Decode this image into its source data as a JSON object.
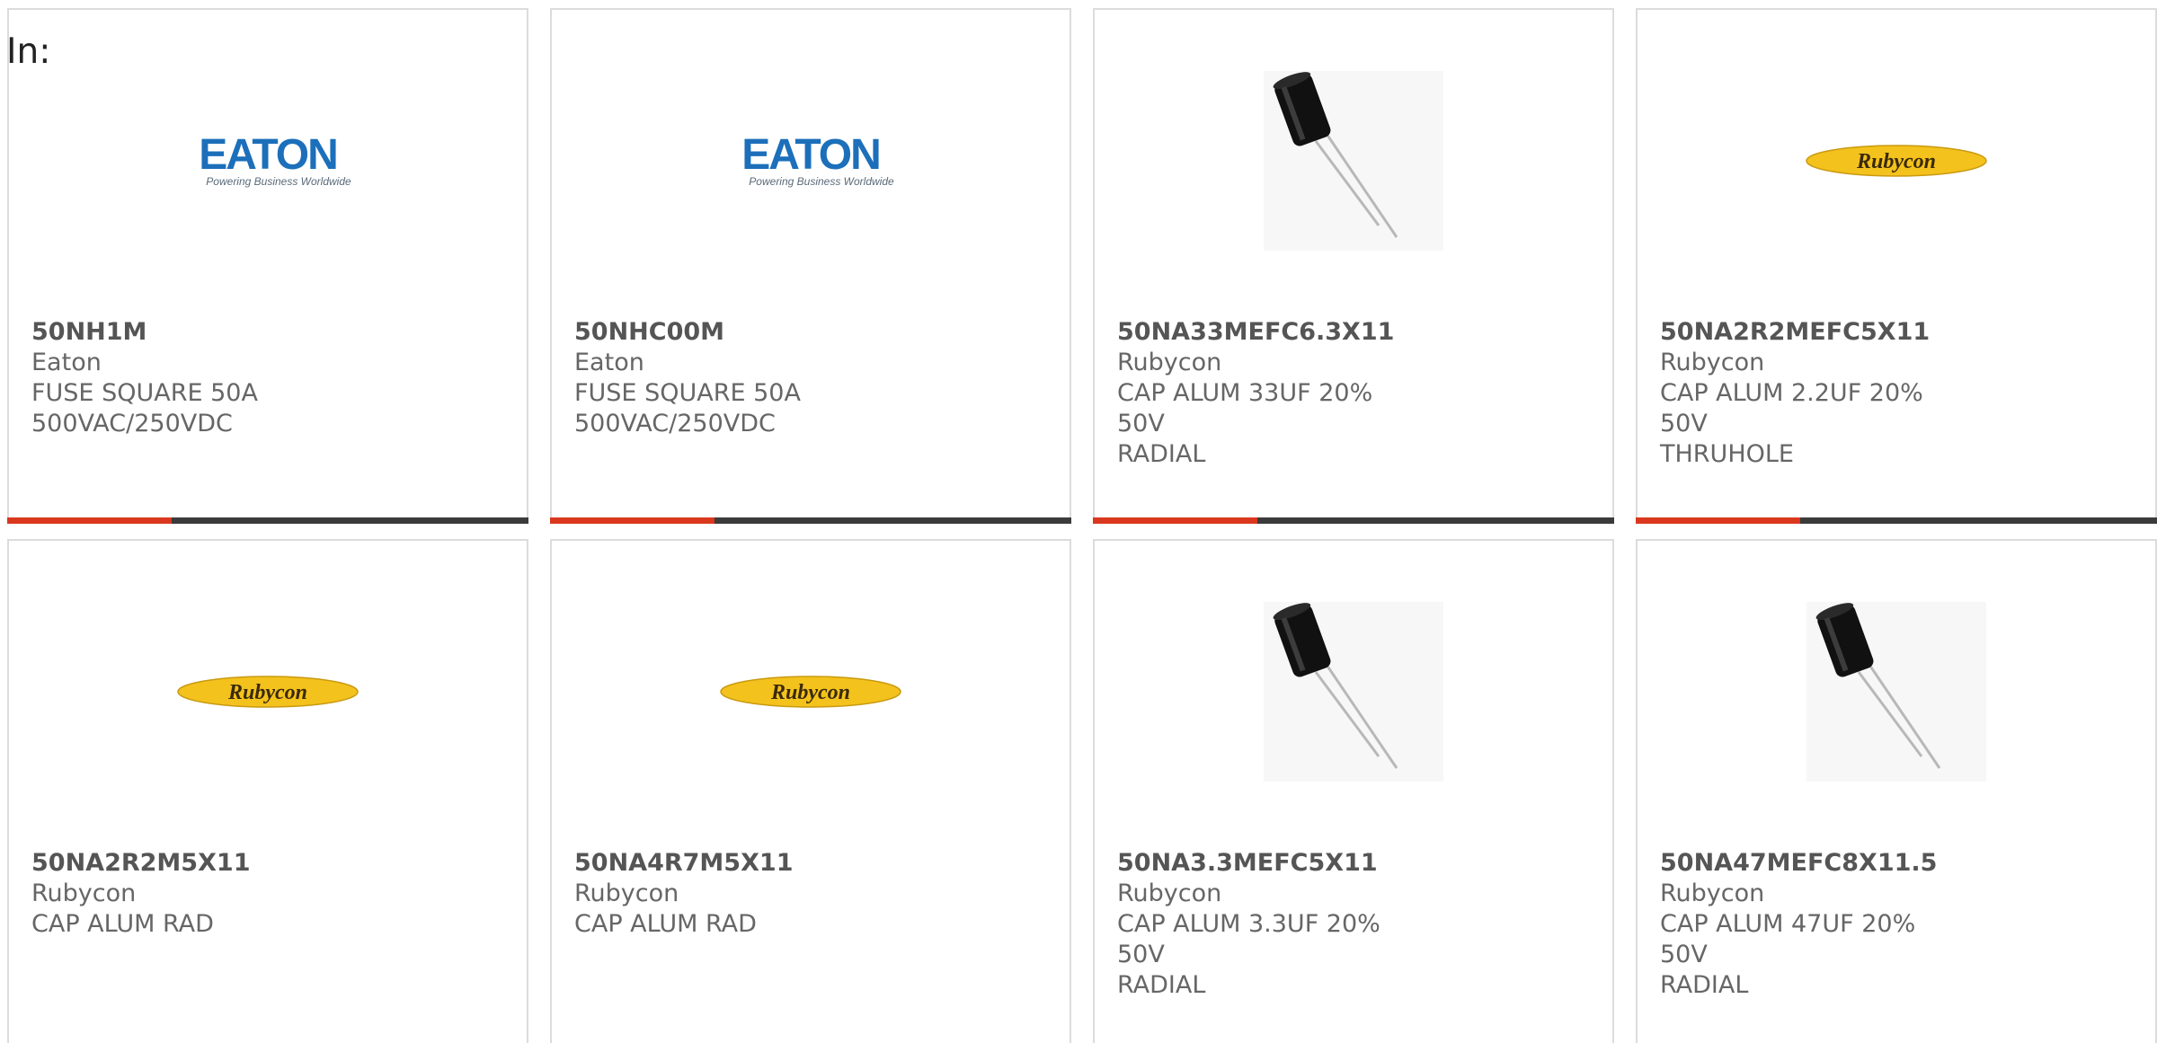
{
  "header": {
    "label": "In:"
  },
  "colors": {
    "accent_bar": "#d9381e",
    "dark_bar": "#3b3b3b",
    "eaton_blue": "#1c6fba",
    "rubycon_yellow": "#f4c21c"
  },
  "products": [
    {
      "part_number": "50NH1M",
      "manufacturer": "Eaton",
      "description_lines": [
        "FUSE SQUARE 50A",
        "500VAC/250VDC"
      ],
      "image": "eaton-logo",
      "logo_tagline": "Powering Business Worldwide"
    },
    {
      "part_number": "50NHC00M",
      "manufacturer": "Eaton",
      "description_lines": [
        "FUSE SQUARE 50A",
        "500VAC/250VDC"
      ],
      "image": "eaton-logo",
      "logo_tagline": "Powering Business Worldwide"
    },
    {
      "part_number": "50NA33MEFC6.3X11",
      "manufacturer": "Rubycon",
      "description_lines": [
        "CAP ALUM 33UF 20% 50V",
        "RADIAL"
      ],
      "image": "capacitor-photo"
    },
    {
      "part_number": "50NA2R2MEFC5X11",
      "manufacturer": "Rubycon",
      "description_lines": [
        "CAP ALUM 2.2UF 20% 50V",
        "THRUHOLE"
      ],
      "image": "rubycon-logo"
    },
    {
      "part_number": "50NA2R2M5X11",
      "manufacturer": "Rubycon",
      "description_lines": [
        "CAP ALUM RAD"
      ],
      "image": "rubycon-logo"
    },
    {
      "part_number": "50NA4R7M5X11",
      "manufacturer": "Rubycon",
      "description_lines": [
        "CAP ALUM RAD"
      ],
      "image": "rubycon-logo"
    },
    {
      "part_number": "50NA3.3MEFC5X11",
      "manufacturer": "Rubycon",
      "description_lines": [
        "CAP ALUM 3.3UF 20% 50V",
        "RADIAL"
      ],
      "image": "capacitor-photo"
    },
    {
      "part_number": "50NA47MEFC8X11.5",
      "manufacturer": "Rubycon",
      "description_lines": [
        "CAP ALUM 47UF 20% 50V",
        "RADIAL"
      ],
      "image": "capacitor-photo"
    }
  ]
}
